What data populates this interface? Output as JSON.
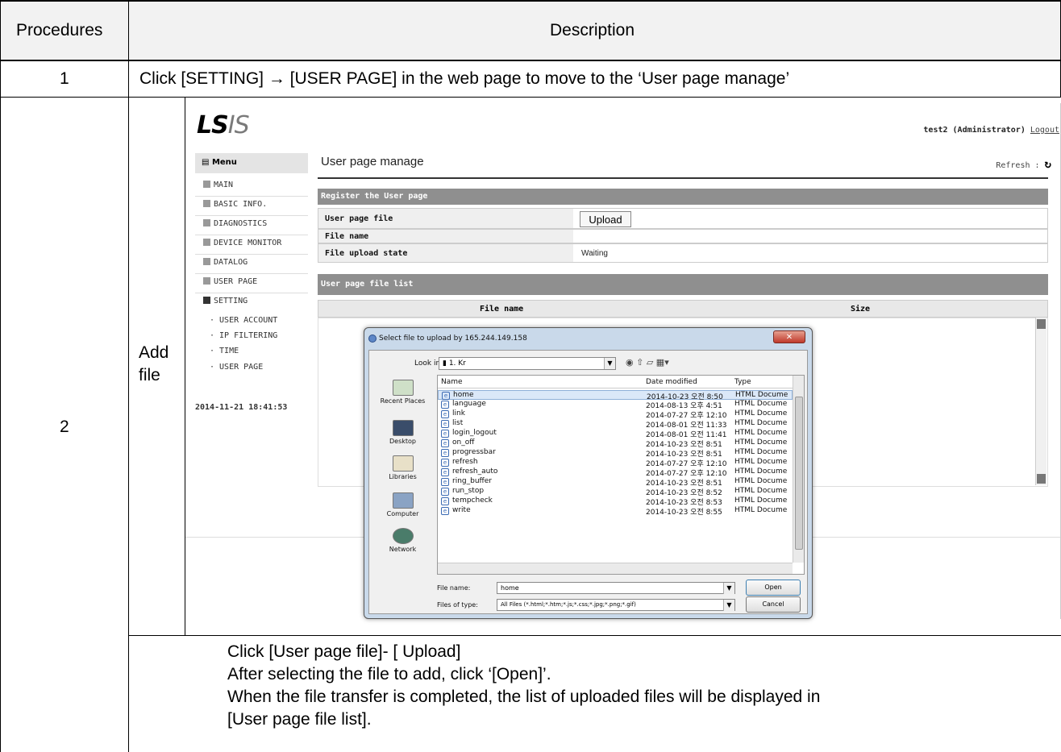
{
  "table": {
    "col1_header": "Procedures",
    "col2_header": "Description",
    "rows": [
      {
        "step": "1",
        "text": "Click [SETTING] → [USER PAGE] in the web page to move to the ‘User page manage’"
      },
      {
        "step": "2",
        "sub_label": "Add file"
      }
    ],
    "notes": [
      "Click [User page file]- [ Upload]",
      "After selecting the file to add, click ‘[Open]’.",
      "When the file transfer is completed, the list of uploaded files will be displayed in",
      "[User page file list]."
    ]
  },
  "app": {
    "logo_ls": "LS",
    "logo_is": "IS",
    "user": "test2 (Administrator)",
    "logout": "Logout",
    "menu_header": "Menu",
    "menu_items": [
      "MAIN",
      "BASIC INFO.",
      "DIAGNOSTICS",
      "DEVICE MONITOR",
      "DATALOG",
      "USER PAGE",
      "SETTING"
    ],
    "sub_items": [
      "· USER ACCOUNT",
      "· IP FILTERING",
      "· TIME",
      "· USER PAGE"
    ],
    "datetime": "2014-11-21 18:41:53",
    "page_title": "User page manage",
    "refresh_label": "Refresh :",
    "register_section": "Register the User page",
    "rows": [
      {
        "label": "User page file",
        "value": ""
      },
      {
        "label": "File name",
        "value": ""
      },
      {
        "label": "File upload state",
        "value": "Waiting"
      }
    ],
    "upload_button": "Upload",
    "list_section": "User page file list",
    "list_col_name": "File name",
    "list_col_size": "Size"
  },
  "dialog": {
    "title": "Select file to upload by 165.244.149.158",
    "look_in_label": "Look in:",
    "look_in_value": "1. Kr",
    "places": [
      "Recent Places",
      "Desktop",
      "Libraries",
      "Computer",
      "Network"
    ],
    "col_name": "Name",
    "col_date": "Date modified",
    "col_type": "Type",
    "files": [
      {
        "name": "home",
        "date": "2014-10-23 오전 8:50",
        "type": "HTML Docume",
        "selected": true
      },
      {
        "name": "language",
        "date": "2014-08-13 오후 4:51",
        "type": "HTML Docume"
      },
      {
        "name": "link",
        "date": "2014-07-27 오후 12:10",
        "type": "HTML Docume"
      },
      {
        "name": "list",
        "date": "2014-08-01 오전 11:33",
        "type": "HTML Docume"
      },
      {
        "name": "login_logout",
        "date": "2014-08-01 오전 11:41",
        "type": "HTML Docume"
      },
      {
        "name": "on_off",
        "date": "2014-10-23 오전 8:51",
        "type": "HTML Docume"
      },
      {
        "name": "progressbar",
        "date": "2014-10-23 오전 8:51",
        "type": "HTML Docume"
      },
      {
        "name": "refresh",
        "date": "2014-07-27 오후 12:10",
        "type": "HTML Docume"
      },
      {
        "name": "refresh_auto",
        "date": "2014-07-27 오후 12:10",
        "type": "HTML Docume"
      },
      {
        "name": "ring_buffer",
        "date": "2014-10-23 오전 8:51",
        "type": "HTML Docume"
      },
      {
        "name": "run_stop",
        "date": "2014-10-23 오전 8:52",
        "type": "HTML Docume"
      },
      {
        "name": "tempcheck",
        "date": "2014-10-23 오전 8:53",
        "type": "HTML Docume"
      },
      {
        "name": "write",
        "date": "2014-10-23 오전 8:55",
        "type": "HTML Docume"
      }
    ],
    "file_name_label": "File name:",
    "file_name_value": "home",
    "files_of_type_label": "Files of type:",
    "files_of_type_value": "All Files (*.html;*.htm;*.js;*.css;*.jpg;*.png;*.gif)",
    "open_button": "Open",
    "cancel_button": "Cancel"
  }
}
